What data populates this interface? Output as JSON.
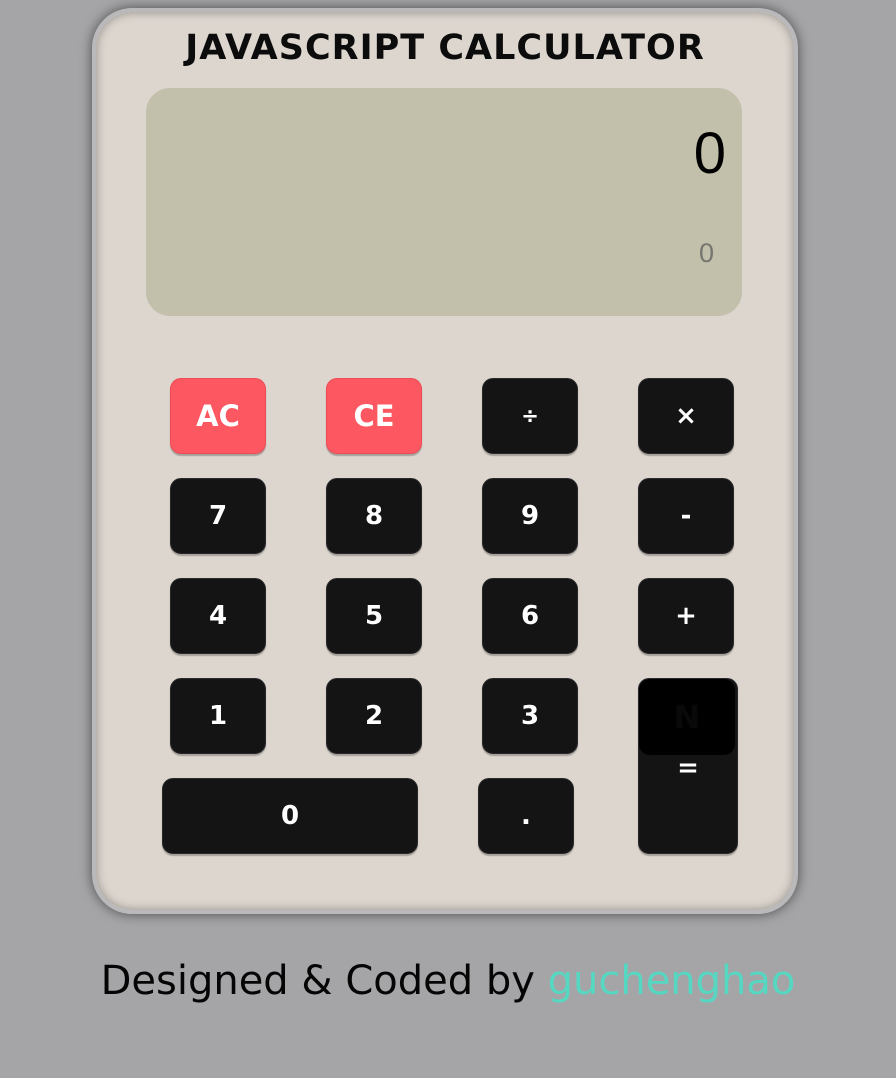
{
  "title": "JAVASCRIPT CALCULATOR",
  "display": {
    "main": "0",
    "sub": "0"
  },
  "keys": {
    "ac": "AC",
    "ce": "CE",
    "divide": "÷",
    "multiply": "×",
    "seven": "7",
    "eight": "8",
    "nine": "9",
    "subtract": "-",
    "four": "4",
    "five": "5",
    "six": "6",
    "add": "+",
    "one": "1",
    "two": "2",
    "three": "3",
    "equals_overlay": "N",
    "equals": "=",
    "zero": "0",
    "decimal": "."
  },
  "footer": {
    "prefix": "Designed & Coded by ",
    "author": "guchenghao"
  },
  "colors": {
    "background": "#a5a5a7",
    "body": "#ddd6cf",
    "display": "#c2c0aa",
    "key": "#151415",
    "key_red": "#fd5761",
    "author_link": "#55d7c2"
  }
}
